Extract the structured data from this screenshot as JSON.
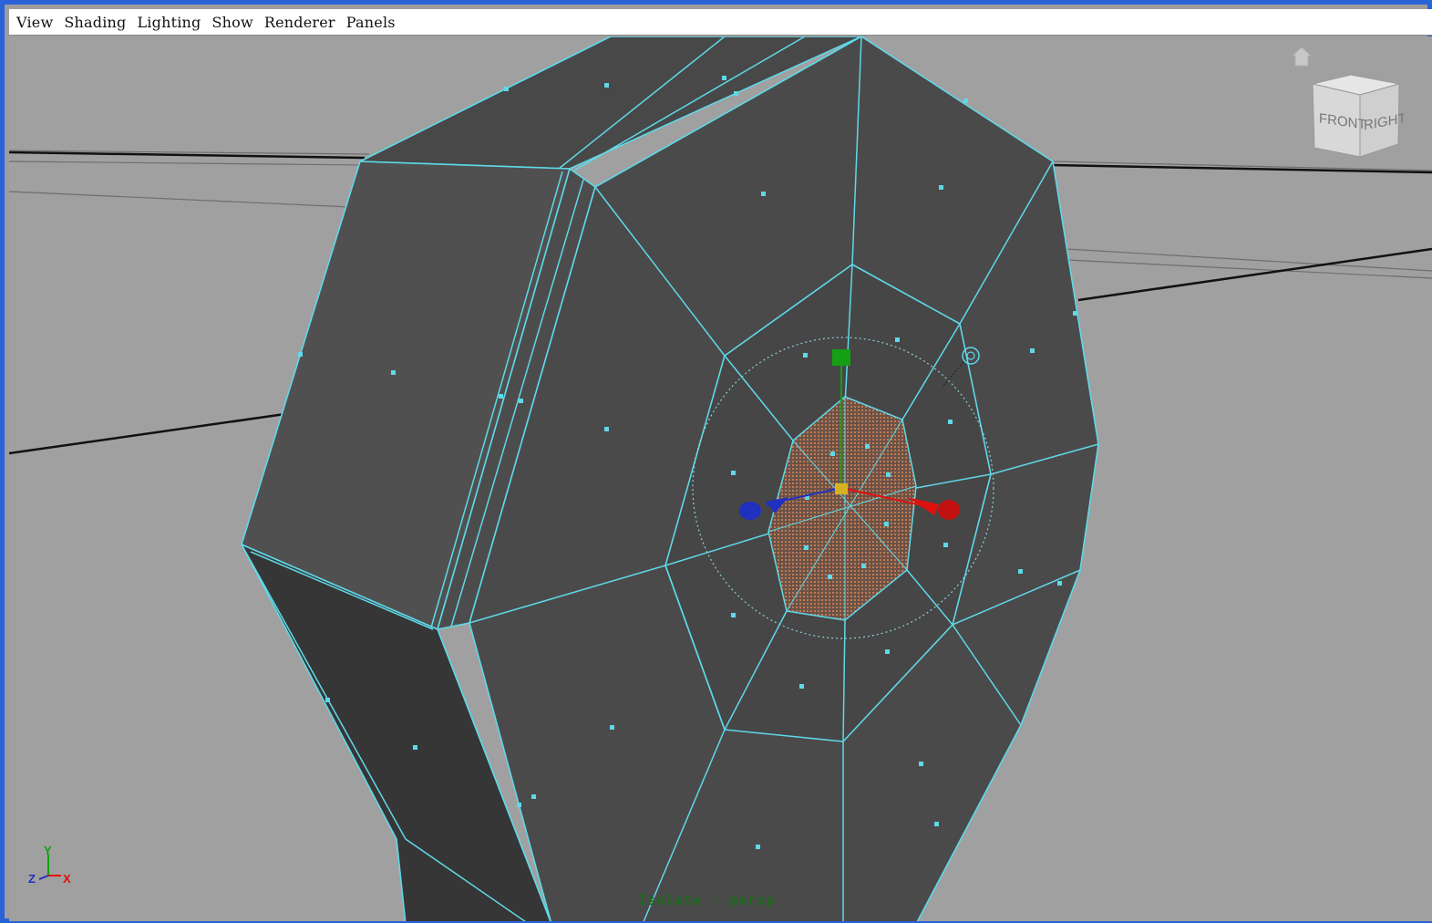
{
  "menu": {
    "items": [
      {
        "label": "View"
      },
      {
        "label": "Shading"
      },
      {
        "label": "Lighting"
      },
      {
        "label": "Show"
      },
      {
        "label": "Renderer"
      },
      {
        "label": "Panels"
      }
    ]
  },
  "viewport": {
    "status_label": "Isolate : persp",
    "view_cube": {
      "front_label": "FRONT",
      "right_label": "RIGHT"
    },
    "axes": {
      "x_label": "X",
      "y_label": "Y",
      "z_label": "Z"
    },
    "colors": {
      "wireframe": "#5fd8e8",
      "background": "#a0a0a0",
      "mesh_face": "#4a4a4a",
      "selected_face": "#b07a5a",
      "x_axis": "#e01010",
      "y_axis": "#10a010",
      "z_axis": "#2030c0",
      "status_text": "#1d6b1d"
    }
  }
}
